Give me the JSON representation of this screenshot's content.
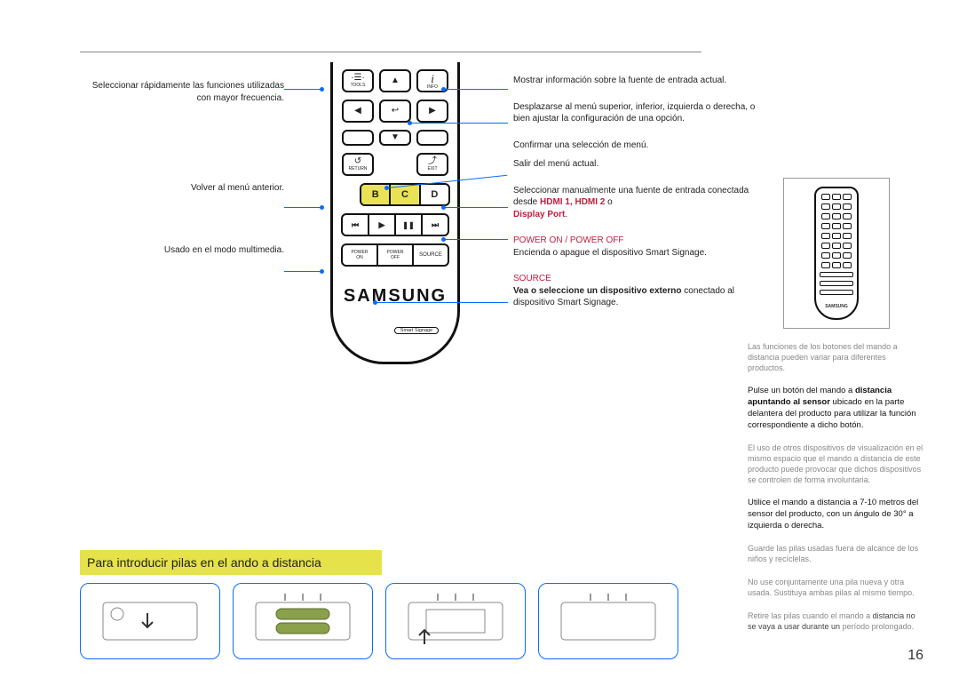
{
  "page_number": "16",
  "section_title": "Para introducir pilas en el ando a distancia",
  "left_callouts": {
    "tools": "Seleccionar rápidamente las funciones utilizadas con mayor frecuencia.",
    "return": "Volver al menú anterior.",
    "media": "Usado en el modo multimedia."
  },
  "remote": {
    "tools_label": "TOOLS",
    "tools_icon": "·☰·",
    "info_label": "INFO",
    "info_icon": "i",
    "return_label": "RETURN",
    "return_icon": "↺",
    "exit_label": "EXIT",
    "exit_icon": "⤴",
    "select_icon": "↩",
    "up_icon": "▲",
    "down_icon": "▼",
    "left_icon": "◀",
    "right_icon": "▶",
    "color_b": "B",
    "color_c": "C",
    "color_d": "D",
    "skip_back": "⏮",
    "play": "▶",
    "pause": "❚❚",
    "skip_fwd": "⏭",
    "power_on_top": "POWER",
    "power_on_bot": "ON",
    "power_off_top": "POWER",
    "power_off_bot": "OFF",
    "source": "SOURCE",
    "smart_signage": "Smart Signage",
    "brand": "SAMSUNG",
    "mini_brand": "SAMSUNG"
  },
  "right_callouts": {
    "info": "Mostrar información sobre la fuente de entrada actual.",
    "nav": "Desplazarse al menú superior, inferior, izquierda o derecha, o bien ajustar la configuración de una opción.",
    "confirm": "Confirmar una selección de menú.",
    "exit": "Salir del menú actual.",
    "source_sel_1": "Seleccionar manualmente una fuente de",
    "source_sel_2": "entrada conectada desde ",
    "source_sel_hdmi": "HDMI 1, HDMI 2",
    "source_sel_or": " o ",
    "source_sel_dp": "Display Port",
    "power_heading": "POWER ON / POWER OFF",
    "power_body": "Encienda o apague el dispositivo Smart Signage.",
    "source_heading": "SOURCE",
    "source_body1": "Vea o seleccione un dispositivo externo",
    "source_body2": "conectado al dispositivo Smart Signage."
  },
  "sidebar": {
    "note1": "Las funciones de los botones del mando a distancia pueden variar para diferentes productos.",
    "para1a": "Pulse un botón del mando a ",
    "para1b": "distancia apuntando al sensor",
    "para1c": " ubicado en la parte delantera del producto para utilizar la función correspondiente a dicho botón.",
    "note2": "El uso de otros dispositivos de visualización en el mismo espacio que el mando a distancia de este producto puede provocar que dichos dispositivos se controlen de forma involuntaria.",
    "para2": "Utilice el mando a distancia a 7-10 metros del sensor del producto, con un ángulo de 30° a izquierda o derecha.",
    "note3": "Guarde las pilas usadas fuera de alcance de los niños y recíclelas.",
    "note4": "No use conjuntamente una pila nueva y otra usada. Sustituya ambas pilas al mismo tiempo.",
    "note5a": "Retire las pilas cuando el mando a ",
    "note5b": "distancia no se vaya a usar durante un",
    "note5c": " período prolongado."
  }
}
